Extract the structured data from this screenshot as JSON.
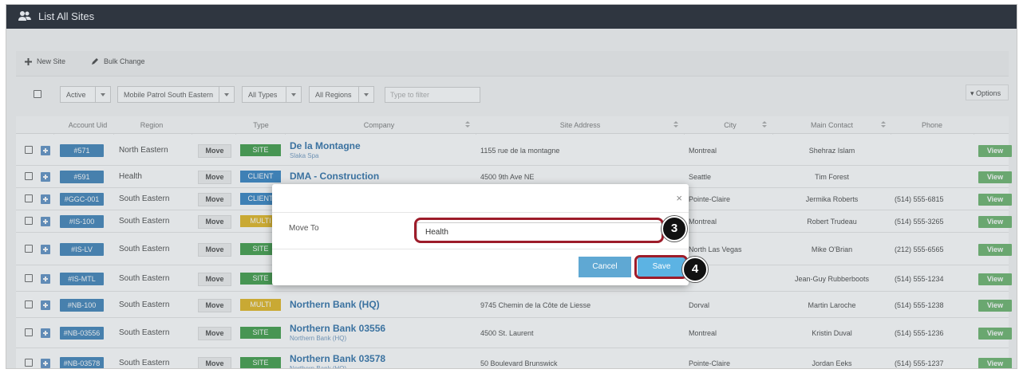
{
  "header": {
    "title": "List All Sites",
    "icon": "users-icon"
  },
  "toolbar": {
    "new_site": "New Site",
    "bulk_change": "Bulk Change"
  },
  "filters": {
    "status": "Active",
    "group": "Mobile Patrol South Eastern",
    "types": "All Types",
    "regions": "All Regions",
    "filter_placeholder": "Type to filter",
    "options": "Options"
  },
  "columns": [
    "Account Uid",
    "Region",
    "Type",
    "Company",
    "Site Address",
    "City",
    "Main Contact",
    "Phone"
  ],
  "rows": [
    {
      "uid": "#571",
      "region": "North Eastern",
      "move": "Move",
      "type": "SITE",
      "type_color": "#3a9a43",
      "company": "De la Montagne",
      "sub": "Slaka Spa",
      "address": "1155 rue de la montagne",
      "city": "Montreal",
      "contact": "Shehraz Islam",
      "phone": "",
      "view": "View"
    },
    {
      "uid": "#591",
      "region": "Health",
      "move": "Move",
      "type": "CLIENT",
      "type_color": "#2f7fc1",
      "company": "DMA - Construction",
      "sub": "",
      "address": "4500 9th Ave NE",
      "city": "Seattle",
      "contact": "Tim Forest",
      "phone": "",
      "view": "View"
    },
    {
      "uid": "#GGC-001",
      "region": "South Eastern",
      "move": "Move",
      "type": "CLIENT",
      "type_color": "#2f7fc1",
      "company": "",
      "sub": "",
      "address": "",
      "city": "Pointe-Claire",
      "contact": "Jermika Roberts",
      "phone": "(514) 555-6815",
      "view": "View"
    },
    {
      "uid": "#IS-100",
      "region": "South Eastern",
      "move": "Move",
      "type": "MULTI",
      "type_color": "#e0b41b",
      "company": "",
      "sub": "",
      "address": "",
      "city": "Montreal",
      "contact": "Robert Trudeau",
      "phone": "(514) 555-3265",
      "view": "View"
    },
    {
      "uid": "#IS-LV",
      "region": "South Eastern",
      "move": "Move",
      "type": "SITE",
      "type_color": "#3a9a43",
      "company": "",
      "sub": "",
      "address": "",
      "city": "North Las Vegas",
      "contact": "Mike O'Brian",
      "phone": "(212) 555-6565",
      "view": "View"
    },
    {
      "uid": "#IS-MTL",
      "region": "South Eastern",
      "move": "Move",
      "type": "SITE",
      "type_color": "#3a9a43",
      "company": "",
      "sub": "",
      "address": "",
      "city": "",
      "contact": "Jean-Guy Rubberboots",
      "phone": "(514) 555-1234",
      "view": "View"
    },
    {
      "uid": "#NB-100",
      "region": "South Eastern",
      "move": "Move",
      "type": "MULTI",
      "type_color": "#e0b41b",
      "company": "Northern Bank (HQ)",
      "sub": "",
      "address": "9745 Chemin de la Côte de Liesse",
      "city": "Dorval",
      "contact": "Martin Laroche",
      "phone": "(514) 555-1238",
      "view": "View"
    },
    {
      "uid": "#NB-03556",
      "region": "South Eastern",
      "move": "Move",
      "type": "SITE",
      "type_color": "#3a9a43",
      "company": "Northern Bank 03556",
      "sub": "Northern Bank (HQ)",
      "address": "4500 St. Laurent",
      "city": "Montreal",
      "contact": "Kristin Duval",
      "phone": "(514) 555-1236",
      "view": "View"
    },
    {
      "uid": "#NB-03578",
      "region": "South Eastern",
      "move": "Move",
      "type": "SITE",
      "type_color": "#3a9a43",
      "company": "Northern Bank 03578",
      "sub": "Northern Bank (HQ)",
      "address": "50 Boulevard Brunswick",
      "city": "Pointe-Claire",
      "contact": "Jordan Eeks",
      "phone": "(514) 555-1237",
      "view": "View"
    }
  ],
  "modal": {
    "close": "×",
    "label": "Move To",
    "value": "Health",
    "cancel": "Cancel",
    "save": "Save",
    "step_input": "3",
    "step_save": "4"
  }
}
